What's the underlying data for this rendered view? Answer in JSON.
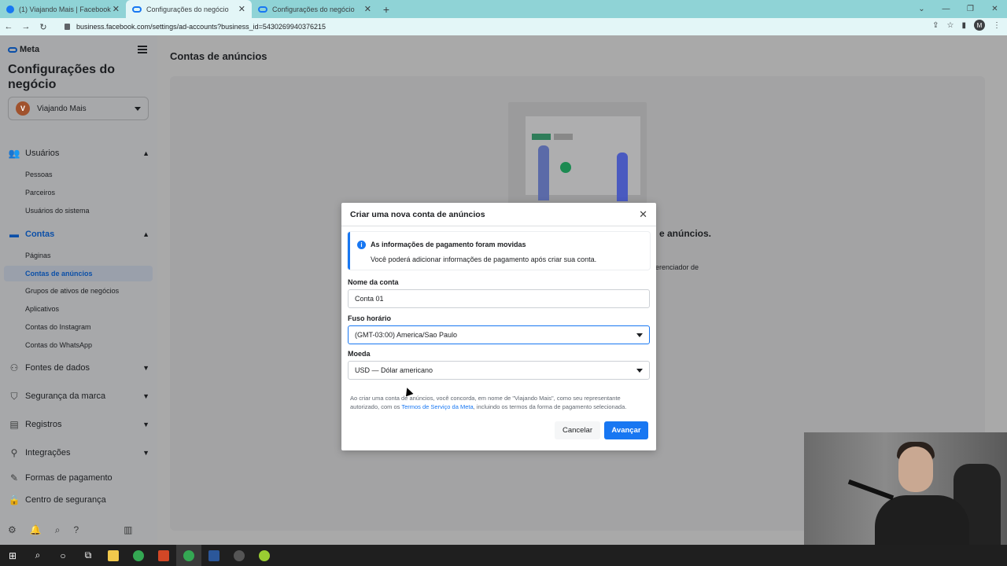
{
  "browser": {
    "tabs": [
      {
        "title": "(1) Viajando Mais | Facebook",
        "active": false
      },
      {
        "title": "Configurações do negócio",
        "active": true
      },
      {
        "title": "Configurações do negócio",
        "active": false
      }
    ],
    "url": "business.facebook.com/settings/ad-accounts?business_id=5430269940376215",
    "profile_initial": "M"
  },
  "sidebar": {
    "logo": "Meta",
    "title": "Configurações do negócio",
    "account": {
      "initial": "V",
      "name": "Viajando Mais"
    },
    "sections": {
      "usuarios": "Usuários",
      "usuarios_items": [
        "Pessoas",
        "Parceiros",
        "Usuários do sistema"
      ],
      "contas": "Contas",
      "contas_items": [
        "Páginas",
        "Contas de anúncios",
        "Grupos de ativos de negócios",
        "Aplicativos",
        "Contas do Instagram",
        "Contas do WhatsApp"
      ],
      "fontes": "Fontes de dados",
      "seguranca": "Segurança da marca",
      "registros": "Registros",
      "integracoes": "Integrações",
      "formas": "Formas de pagamento",
      "centro": "Centro de segurança"
    }
  },
  "main": {
    "title": "Contas de anúncios",
    "bg_heading_tail": "e anúncios.",
    "bg_text_tail": "erenciador de"
  },
  "modal": {
    "title": "Criar uma nova conta de anúncios",
    "notice_title": "As informações de pagamento foram movidas",
    "notice_body": "Você poderá adicionar informações de pagamento após criar sua conta.",
    "name_label": "Nome da conta",
    "name_value": "Conta 01",
    "tz_label": "Fuso horário",
    "tz_value": "(GMT-03:00) America/Sao Paulo",
    "currency_label": "Moeda",
    "currency_value": "USD — Dólar americano",
    "legal_prefix": "Ao criar uma conta de anúncios, você concorda, em nome de \"Viajando Mais\", como seu representante autorizado, com os ",
    "legal_link": "Termos de Serviço da Meta",
    "legal_suffix": ", incluindo os termos da forma de pagamento selecionada.",
    "cancel_label": "Cancelar",
    "next_label": "Avançar"
  },
  "colors": {
    "accent": "#1877f2",
    "tabbar": "#8fd3d6"
  }
}
